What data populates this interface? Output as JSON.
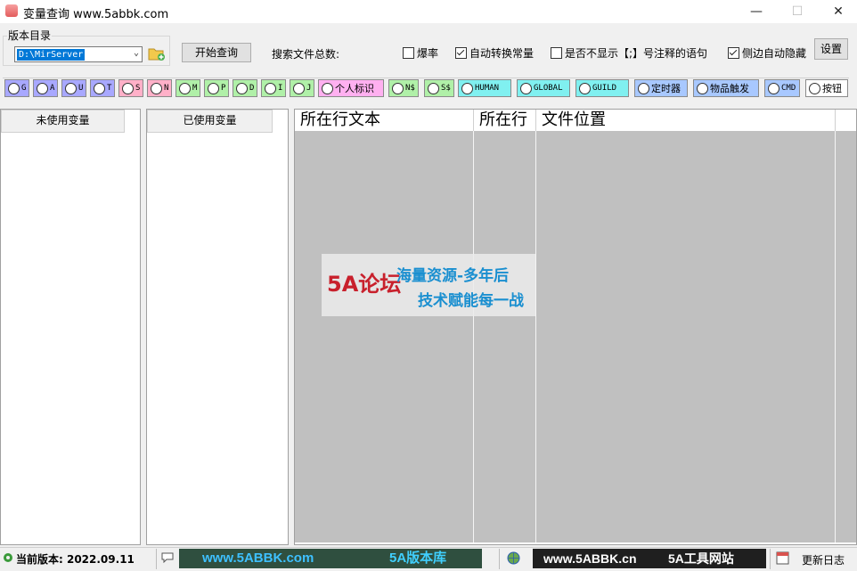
{
  "window": {
    "title": "变量查询 www.5abbk.com",
    "minimize": "—",
    "maximize": "☐",
    "close": "✕"
  },
  "toolbar": {
    "version_label": "版本目录",
    "version_value": "D:\\MirServer",
    "query_button": "开始查询",
    "total_label": "搜索文件总数:",
    "checkboxes": [
      {
        "label": "爆率",
        "checked": false
      },
      {
        "label": "自动转换常量",
        "checked": true
      },
      {
        "label": "是否不显示【;】号注释的语句",
        "checked": false
      },
      {
        "label": "侧边自动隐藏",
        "checked": true
      }
    ],
    "settings_button": "设置"
  },
  "var_buttons": [
    {
      "label": "G",
      "color": "#a8a8ff"
    },
    {
      "label": "A",
      "color": "#a8a8ff"
    },
    {
      "label": "U",
      "color": "#a8a8ff"
    },
    {
      "label": "T",
      "color": "#a8a8ff"
    },
    {
      "label": "S",
      "color": "#ffb0c8"
    },
    {
      "label": "N",
      "color": "#ffb0c8"
    },
    {
      "label": "M",
      "color": "#b0f0a8"
    },
    {
      "label": "P",
      "color": "#b0f0a8"
    },
    {
      "label": "D",
      "color": "#b0f0a8"
    },
    {
      "label": "I",
      "color": "#b0f0a8"
    },
    {
      "label": "J",
      "color": "#b0f0a8"
    },
    {
      "label": "个人标识",
      "color": "#ffb0f0"
    },
    {
      "label": "N$",
      "color": "#b0f0a8"
    },
    {
      "label": "S$",
      "color": "#b0f0a8"
    },
    {
      "label": "HUMAN",
      "color": "#80f0f0"
    },
    {
      "label": "GLOBAL",
      "color": "#80f0f0"
    },
    {
      "label": "GUILD",
      "color": "#80f0f0"
    },
    {
      "label": "定时器",
      "color": "#a8c8ff"
    },
    {
      "label": "物品触发",
      "color": "#a8c8ff"
    },
    {
      "label": "CMD",
      "color": "#a8c8ff"
    },
    {
      "label": "按钮",
      "color": "#ffffff"
    }
  ],
  "panels": {
    "unused_header": "未使用变量",
    "used_header": "已使用变量"
  },
  "grid": {
    "columns": [
      "所在行文本",
      "所在行",
      "文件位置"
    ]
  },
  "watermark": {
    "logo": "5A论坛",
    "line1": "海量资源-多年后",
    "line2": "技术赋能每一战"
  },
  "status": {
    "version_text": "当前版本:  2022.09.11",
    "banner1_left": "www.5ABBK.com",
    "banner1_right": "5A版本库",
    "banner2_left": "www.5ABBK.cn",
    "banner2_right": "5A工具网站",
    "changelog": "更新日志"
  }
}
